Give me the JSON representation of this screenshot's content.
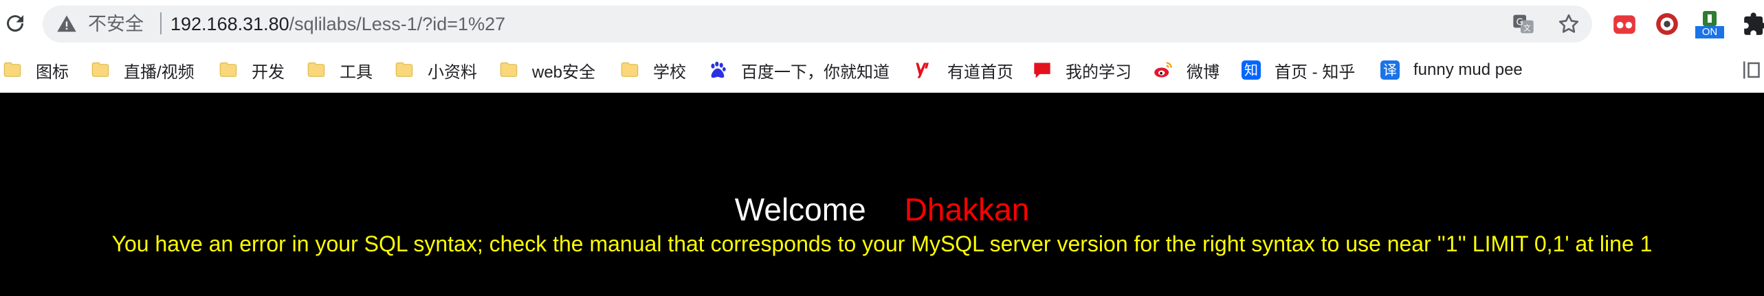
{
  "browser": {
    "address_bar": {
      "security_label": "不安全",
      "url_host": "192.168.31.80",
      "url_path": "/sqlilabs/Less-1/?id=1%27"
    },
    "icons": {
      "reload": "reload-icon",
      "warning": "warning-icon",
      "translate": "translate-icon",
      "star": "star-icon",
      "extensions": [
        "extension-red-icon",
        "extension-record-icon",
        "extension-on-icon",
        "extensions-puzzle-icon"
      ]
    },
    "extension_badge": "ON"
  },
  "bookmarks": [
    {
      "label": "图标",
      "icon": "folder-icon"
    },
    {
      "label": "直播/视频",
      "icon": "folder-icon"
    },
    {
      "label": "开发",
      "icon": "folder-icon"
    },
    {
      "label": "工具",
      "icon": "folder-icon"
    },
    {
      "label": "小资料",
      "icon": "folder-icon"
    },
    {
      "label": "web安全",
      "icon": "folder-icon"
    },
    {
      "label": "学校",
      "icon": "folder-icon"
    },
    {
      "label": "百度一下，你就知道",
      "icon": "baidu-icon"
    },
    {
      "label": "有道首页",
      "icon": "youdao-icon"
    },
    {
      "label": "我的学习",
      "icon": "study-icon"
    },
    {
      "label": "微博",
      "icon": "weibo-icon"
    },
    {
      "label": "首页 - 知乎",
      "icon": "zhihu-icon"
    },
    {
      "label": "funny mud pee",
      "icon": "translate-badge-icon"
    }
  ],
  "page": {
    "welcome": "Welcome",
    "username": "Dhakkan",
    "error_message": "You have an error in your SQL syntax; check the manual that corresponds to your MySQL server version for the right syntax to use near ''1'' LIMIT 0,1' at line 1"
  },
  "colors": {
    "page_background": "#000000",
    "welcome_text": "#ffffff",
    "username_text": "#ff0000",
    "error_text": "#ffff00",
    "folder": "#f9d77a"
  },
  "zhihu_glyph": "知",
  "translate_glyph": "译"
}
